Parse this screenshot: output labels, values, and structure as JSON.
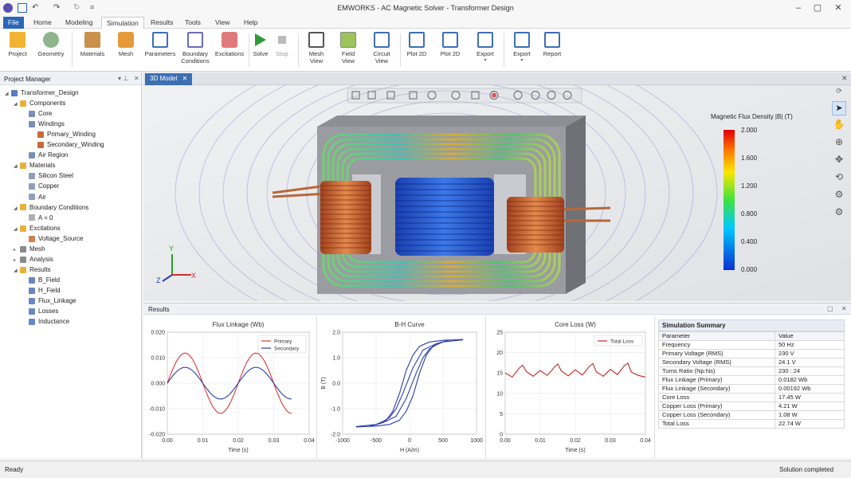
{
  "window": {
    "title": "EMWORKS - AC Magnetic Solver - Transformer Design"
  },
  "menu": {
    "tabs": [
      "File",
      "Home",
      "Modeling",
      "Simulation",
      "Results",
      "Tools",
      "View",
      "Help"
    ],
    "active": "Simulation"
  },
  "ribbon": {
    "buttons": [
      "Project",
      "Geometry",
      "Materials",
      "Mesh",
      "Parameters",
      "Boundary\nConditions",
      "Excitations",
      "Solve",
      "Stop",
      "Mesh\nView",
      "Field\nView",
      "Circuit\nView",
      "Plot 2D",
      "Plot 2D",
      "Export",
      "Export",
      "Report"
    ]
  },
  "project_manager": {
    "title": "Project Manager",
    "tree": [
      {
        "label": "Transformer_Design",
        "level": 0,
        "icon": "project-icon"
      },
      {
        "label": "Components",
        "level": 1,
        "icon": "folder-icon"
      },
      {
        "label": "Core",
        "level": 2,
        "icon": "cube-icon"
      },
      {
        "label": "Windings",
        "level": 2,
        "icon": "cube-icon"
      },
      {
        "label": "Primary_Winding",
        "level": 3,
        "icon": "coil-icon"
      },
      {
        "label": "Secondary_Winding",
        "level": 3,
        "icon": "coil-icon"
      },
      {
        "label": "Air Region",
        "level": 2,
        "icon": "cube-icon"
      },
      {
        "label": "Materials",
        "level": 1,
        "icon": "folder-icon"
      },
      {
        "label": "Silicon Steel",
        "level": 2,
        "icon": "material-icon"
      },
      {
        "label": "Copper",
        "level": 2,
        "icon": "material-icon"
      },
      {
        "label": "Air",
        "level": 2,
        "icon": "material-icon"
      },
      {
        "label": "Boundary Conditions",
        "level": 1,
        "icon": "folder-icon"
      },
      {
        "label": "A = 0",
        "level": 2,
        "icon": "boundary-icon"
      },
      {
        "label": "Excitations",
        "level": 1,
        "icon": "folder-icon"
      },
      {
        "label": "Voltage_Source",
        "level": 2,
        "icon": "source-icon"
      },
      {
        "label": "Mesh",
        "level": 1,
        "icon": "mesh-icon"
      },
      {
        "label": "Analysis",
        "level": 1,
        "icon": "analysis-icon"
      },
      {
        "label": "Results",
        "level": 1,
        "icon": "folder-icon"
      },
      {
        "label": "B_Field",
        "level": 2,
        "icon": "result-icon"
      },
      {
        "label": "H_Field",
        "level": 2,
        "icon": "result-icon"
      },
      {
        "label": "Flux_Linkage",
        "level": 2,
        "icon": "result-icon"
      },
      {
        "label": "Losses",
        "level": 2,
        "icon": "result-icon"
      },
      {
        "label": "Inductance",
        "level": 2,
        "icon": "result-icon"
      }
    ]
  },
  "viewport": {
    "tab": "3D Model",
    "legend": {
      "title": "Magnetic Flux Density |B| (T)",
      "ticks": [
        "2.000",
        "1.600",
        "1.200",
        "0.800",
        "0.400",
        "0.000"
      ]
    },
    "axes": {
      "x": "X",
      "y": "Y",
      "z": "Z"
    }
  },
  "results": {
    "title": "Results"
  },
  "chart_data": [
    {
      "type": "line",
      "title": "Flux Linkage (Wb)",
      "xlabel": "Time (s)",
      "ylabel": "",
      "xlim": [
        0,
        0.04
      ],
      "ylim": [
        -0.02,
        0.02
      ],
      "xticks": [
        "0.00",
        "0.01",
        "0.02",
        "0.03",
        "0.04"
      ],
      "yticks": [
        "0.020",
        "0.010",
        "0.000",
        "-0.010",
        "-0.020"
      ],
      "legend": "top-right",
      "series": [
        {
          "name": "Primary",
          "color": "#d83a3a",
          "x": [
            0,
            0.0025,
            0.005,
            0.0075,
            0.01,
            0.0125,
            0.015,
            0.0175,
            0.02,
            0.0225,
            0.025,
            0.0275,
            0.03,
            0.0325,
            0.035
          ],
          "y": [
            0,
            0.0088,
            0.0118,
            0.0088,
            0,
            -0.0088,
            -0.0118,
            -0.0088,
            0,
            0.0088,
            0.0118,
            0.0088,
            0,
            -0.0088,
            -0.0118
          ]
        },
        {
          "name": "Secondary",
          "color": "#2a3fa8",
          "x": [
            0,
            0.0025,
            0.005,
            0.0075,
            0.01,
            0.0125,
            0.015,
            0.0175,
            0.02,
            0.0225,
            0.025,
            0.0275,
            0.03,
            0.0325,
            0.035
          ],
          "y": [
            0,
            0.0046,
            0.0062,
            0.0046,
            0,
            -0.0046,
            -0.0062,
            -0.0046,
            0,
            0.0046,
            0.0062,
            0.0046,
            0,
            -0.0046,
            -0.0062
          ]
        }
      ]
    },
    {
      "type": "line",
      "title": "B-H Curve",
      "xlabel": "H (A/m)",
      "ylabel": "B (T)",
      "xlim": [
        -1000,
        1000
      ],
      "ylim": [
        -2,
        2
      ],
      "xticks": [
        "-1000",
        "-500",
        "0",
        "500",
        "1000"
      ],
      "yticks": [
        "2.0",
        "1.0",
        "0.0",
        "-1.0",
        "-2.0"
      ],
      "series": [
        {
          "name": "",
          "color": "#2a3fa8",
          "x": [
            -800,
            -500,
            -350,
            -250,
            -150,
            -50,
            50,
            150,
            300,
            500,
            800
          ],
          "y": [
            -1.7,
            -1.62,
            -1.45,
            -1.1,
            -0.4,
            0.5,
            1.1,
            1.45,
            1.62,
            1.68,
            1.72
          ]
        },
        {
          "name": "",
          "color": "#2a3fa8",
          "x": [
            -800,
            -500,
            -300,
            -150,
            -50,
            50,
            150,
            250,
            350,
            500,
            800
          ],
          "y": [
            -1.72,
            -1.68,
            -1.62,
            -1.45,
            -1.1,
            -0.5,
            0.4,
            1.1,
            1.45,
            1.62,
            1.7
          ]
        },
        {
          "name": "",
          "color": "#2a3fa8",
          "x": [
            -600,
            -400,
            -200,
            -50,
            100,
            200,
            300,
            450,
            600
          ],
          "y": [
            -1.7,
            -1.55,
            -1.3,
            -0.6,
            0.4,
            1.0,
            1.35,
            1.58,
            1.7
          ]
        },
        {
          "name": "",
          "color": "#2a3fa8",
          "x": [
            -600,
            -450,
            -300,
            -200,
            -100,
            50,
            200,
            400,
            600
          ],
          "y": [
            -1.7,
            -1.58,
            -1.35,
            -1.0,
            -0.4,
            0.6,
            1.3,
            1.55,
            1.7
          ]
        }
      ]
    },
    {
      "type": "line",
      "title": "Core Loss (W)",
      "xlabel": "Time (s)",
      "ylabel": "",
      "xlim": [
        0,
        0.04
      ],
      "ylim": [
        0,
        25
      ],
      "xticks": [
        "0.00",
        "0.01",
        "0.02",
        "0.03",
        "0.04"
      ],
      "yticks": [
        "25",
        "20",
        "15",
        "10",
        "5",
        "0"
      ],
      "legend": "top-right",
      "series": [
        {
          "name": "Total Loss",
          "color": "#c62828",
          "x": [
            0,
            0.002,
            0.004,
            0.005,
            0.006,
            0.008,
            0.01,
            0.012,
            0.014,
            0.015,
            0.016,
            0.018,
            0.02,
            0.022,
            0.024,
            0.025,
            0.026,
            0.028,
            0.03,
            0.032,
            0.034,
            0.035,
            0.036,
            0.038,
            0.04
          ],
          "y": [
            15.0,
            14.0,
            16.2,
            16.9,
            15.4,
            14.2,
            15.6,
            14.4,
            16.4,
            17.2,
            15.5,
            14.3,
            15.8,
            14.5,
            16.6,
            17.3,
            15.3,
            14.2,
            15.9,
            14.6,
            16.8,
            17.4,
            15.2,
            14.4,
            14.0
          ]
        }
      ]
    }
  ],
  "summary": {
    "title": "Simulation Summary",
    "header": [
      "Parameter",
      "Value"
    ],
    "rows": [
      [
        "Frequency",
        "50 Hz"
      ],
      [
        "Primary Voltage (RMS)",
        "230 V"
      ],
      [
        "Secondary Voltage (RMS)",
        "24.1 V"
      ],
      [
        "Turns Ratio (Np:Ns)",
        "230 : 24"
      ],
      [
        "Flux Linkage (Primary)",
        "0.0182 Wb"
      ],
      [
        "Flux Linkage (Secondary)",
        "0.00192 Wb"
      ],
      [
        "Core Loss",
        "17.45 W"
      ],
      [
        "Copper Loss (Primary)",
        "4.21 W"
      ],
      [
        "Copper Loss (Secondary)",
        "1.08 W"
      ],
      [
        "Total Loss",
        "22.74 W"
      ]
    ]
  },
  "status": {
    "left": "Ready",
    "right": "Solution completed"
  }
}
